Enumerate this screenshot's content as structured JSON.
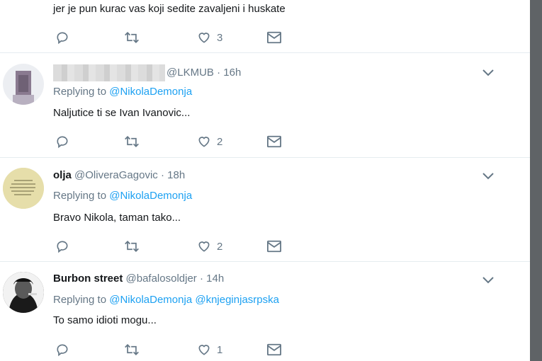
{
  "top_tweet": {
    "text": "jer je pun kurac vas koji sedite zavaljeni i huskate",
    "likes": "3"
  },
  "tweets": [
    {
      "name": "",
      "handle": "@LKMUB",
      "time": "16h",
      "replying_label": "Replying to",
      "mentions": [
        "@NikolaDemonja"
      ],
      "text": "Naljutice ti se Ivan Ivanovic...",
      "likes": "2"
    },
    {
      "name": "olja",
      "handle": "@OliveraGagovic",
      "time": "18h",
      "replying_label": "Replying to",
      "mentions": [
        "@NikolaDemonja"
      ],
      "text": "Bravo Nikola, taman tako...",
      "likes": "2"
    },
    {
      "name": "Burbon street",
      "handle": "@bafalosoldjer",
      "time": "14h",
      "replying_label": "Replying to",
      "mentions": [
        "@NikolaDemonja",
        "@knjeginjasrpska"
      ],
      "text": "To samo idioti mogu...",
      "likes": "1"
    }
  ],
  "icons": {
    "reply": "reply-icon",
    "retweet": "retweet-icon",
    "like": "heart-icon",
    "dm": "envelope-icon",
    "more": "chevron-down-icon"
  },
  "colors": {
    "link": "#1da1f2",
    "muted": "#657786",
    "text": "#14171a",
    "border": "#e6ecf0",
    "scrollbar": "#5f6366"
  }
}
